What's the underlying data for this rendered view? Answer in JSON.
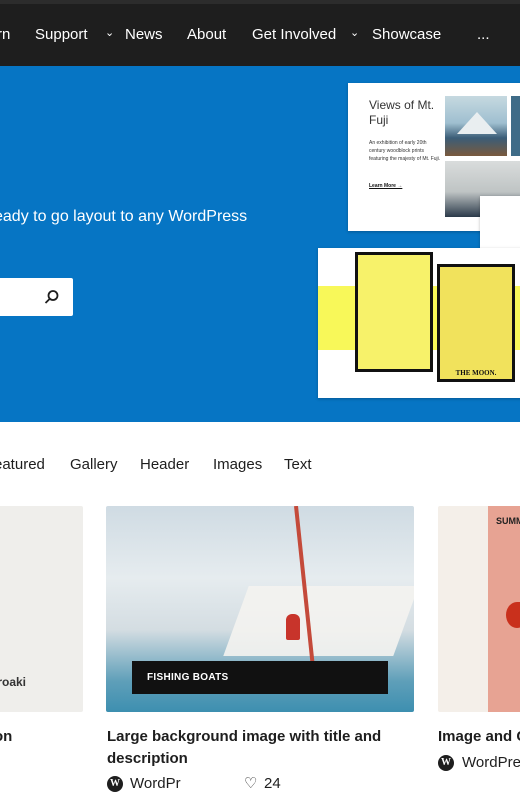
{
  "nav": {
    "items": [
      {
        "label": "rn",
        "has_dropdown": false
      },
      {
        "label": "Support",
        "has_dropdown": true
      },
      {
        "label": "News",
        "has_dropdown": false
      },
      {
        "label": "About",
        "has_dropdown": false
      },
      {
        "label": "Get Involved",
        "has_dropdown": true
      },
      {
        "label": "Showcase",
        "has_dropdown": false
      },
      {
        "label": "...",
        "has_dropdown": false
      }
    ]
  },
  "hero": {
    "text": "eady to go layout to any WordPress",
    "text_line2": ".",
    "background_color": "#0675c4",
    "search_icon": "search-icon",
    "fuji_card": {
      "title": "Views of Mt. Fuji",
      "description": "An exhibition of early 20th century woodblock prints featuring the majesty of Mt. Fuji.",
      "link": "Learn More →"
    },
    "tarot_card": {
      "card_label": "THE MOON."
    }
  },
  "filters": {
    "tabs": [
      "eatured",
      "Gallery",
      "Header",
      "Images",
      "Text"
    ]
  },
  "patterns": [
    {
      "title": "on",
      "thumb_text": "iroaki"
    },
    {
      "title": "Large background image with title and description",
      "caption": "FISHING BOATS",
      "author": "WordPr",
      "likes": "24"
    },
    {
      "title": "Image and C",
      "thumb_text": "SUMM",
      "author": "WordPre"
    }
  ]
}
